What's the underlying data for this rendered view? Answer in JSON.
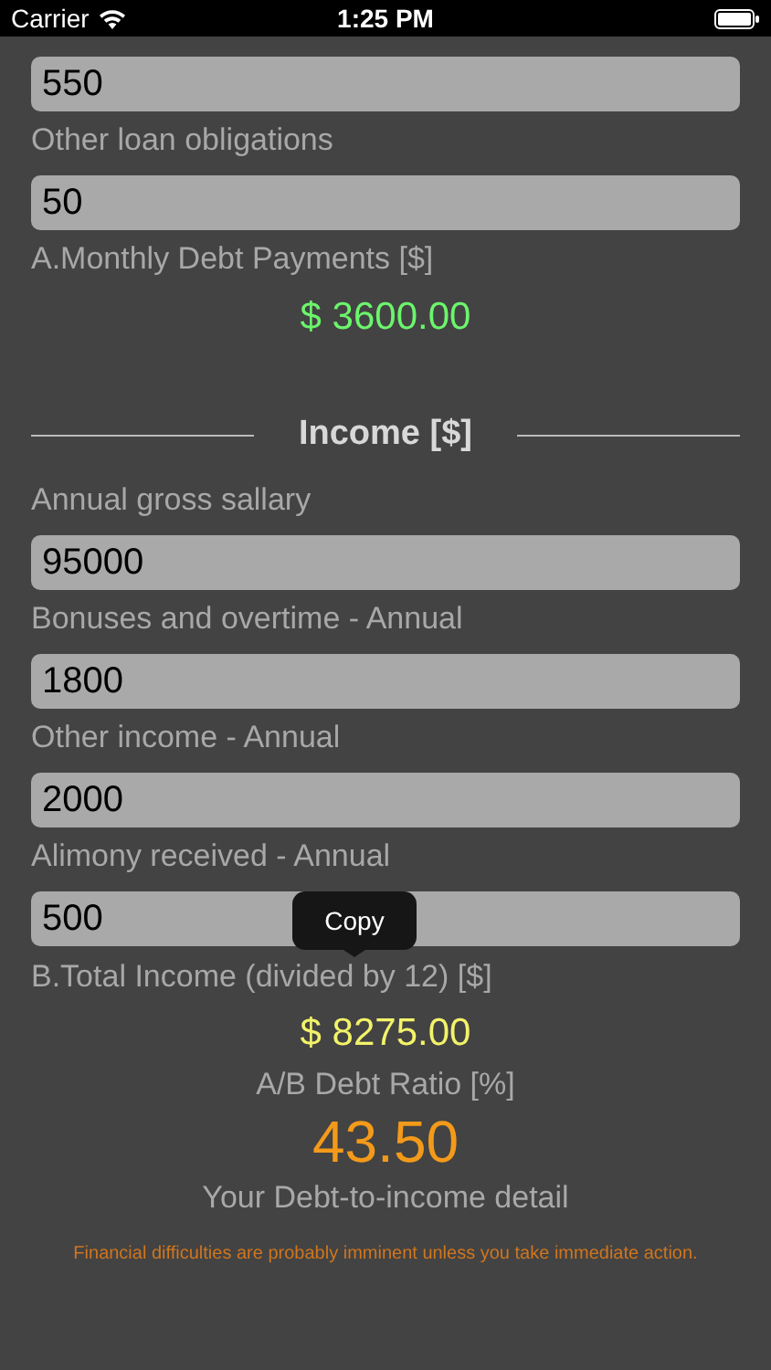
{
  "status_bar": {
    "carrier": "Carrier",
    "time": "1:25 PM"
  },
  "debt_fields": [
    {
      "value": "550"
    },
    {
      "label": "Other loan obligations",
      "value": "50"
    }
  ],
  "debt_total": {
    "label": "A.Monthly Debt Payments [$]",
    "value": "$ 3600.00"
  },
  "income_heading": "Income [$]",
  "income_fields": [
    {
      "label": "Annual gross sallary",
      "value": "95000"
    },
    {
      "label": "Bonuses and overtime - Annual",
      "value": "1800"
    },
    {
      "label": "Other income - Annual",
      "value": "2000"
    },
    {
      "label": "Alimony received - Annual",
      "value": "500"
    }
  ],
  "income_total": {
    "label": "B.Total Income (divided by 12) [$]",
    "value": "$ 8275.00"
  },
  "ratio": {
    "label": "A/B Debt Ratio [%]",
    "value": "43.50",
    "detail": "Your Debt-to-income detail",
    "warning": "Financial difficulties are probably imminent unless you take immediate action."
  },
  "popup": {
    "label": "Copy"
  }
}
